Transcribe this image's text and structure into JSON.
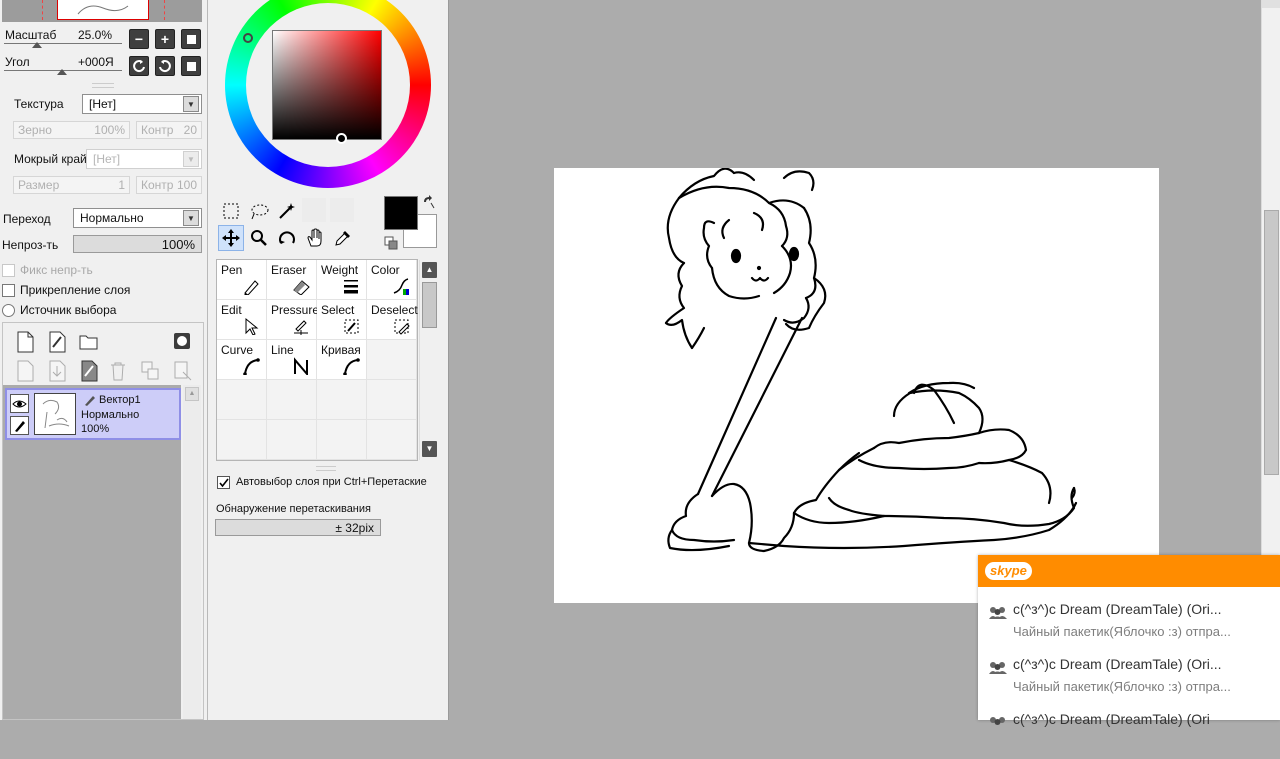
{
  "navigator": {
    "zoom_label": "Масштаб",
    "zoom_value": "25.0%",
    "angle_label": "Угол",
    "angle_value": "+000Я"
  },
  "brush": {
    "texture_label": "Текстура",
    "texture_value": "[Нет]",
    "grain_label": "Зерно",
    "grain_value": "100%",
    "contrast1_label": "Контр",
    "contrast1_value": "20",
    "wet_edge_label": "Мокрый край",
    "wet_edge_value": "[Нет]",
    "size_label": "Размер",
    "size_value": "1",
    "contrast2_label": "Контр",
    "contrast2_value": "100"
  },
  "layer_props": {
    "blend_label": "Переход",
    "blend_value": "Нормально",
    "opacity_label": "Непроз-ть",
    "opacity_value": "100%",
    "opacity_fraction": 1.0,
    "fix_opacity_label": "Фикс непр-ть",
    "clip_label": "Прикрепление слоя",
    "selection_source_label": "Источник выбора"
  },
  "layer": {
    "name": "Вектор1",
    "mode": "Нормально",
    "opacity": "100%"
  },
  "tools": [
    {
      "name": "Pen",
      "icon": "pen-icon"
    },
    {
      "name": "Eraser",
      "icon": "eraser-icon"
    },
    {
      "name": "Weight",
      "icon": "weight-icon"
    },
    {
      "name": "Color",
      "icon": "color-icon"
    },
    {
      "name": "Edit",
      "icon": "edit-icon"
    },
    {
      "name": "Pressure",
      "icon": "pressure-icon"
    },
    {
      "name": "Select",
      "icon": "select-icon"
    },
    {
      "name": "Deselect",
      "icon": "deselect-icon"
    },
    {
      "name": "Curve",
      "icon": "curve-icon"
    },
    {
      "name": "Line",
      "icon": "line-icon"
    },
    {
      "name": "Кривая",
      "icon": "curve-ru-icon"
    }
  ],
  "tool_options": {
    "auto_select_label": "Автовыбор слоя при Ctrl+Перетаские",
    "drag_detect_label": "Обнаружение перетаскивания",
    "drag_detect_value": "± 32pix"
  },
  "colors": {
    "primary": "#000000",
    "secondary": "#ffffff",
    "skype_orange": "#ff8c00"
  },
  "skype": {
    "logo": "skype",
    "items": [
      {
        "title": "с(^з^)с Dream (DreamTale) (Ori...",
        "message": "Чайный пакетик(Яблочко :з) отпра..."
      },
      {
        "title": "с(^з^)с Dream (DreamTale) (Ori...",
        "message": "Чайный пакетик(Яблочко :з) отпра..."
      },
      {
        "title": "с(^з^)с Dream (DreamTale) (Ori",
        "message": ""
      }
    ]
  }
}
